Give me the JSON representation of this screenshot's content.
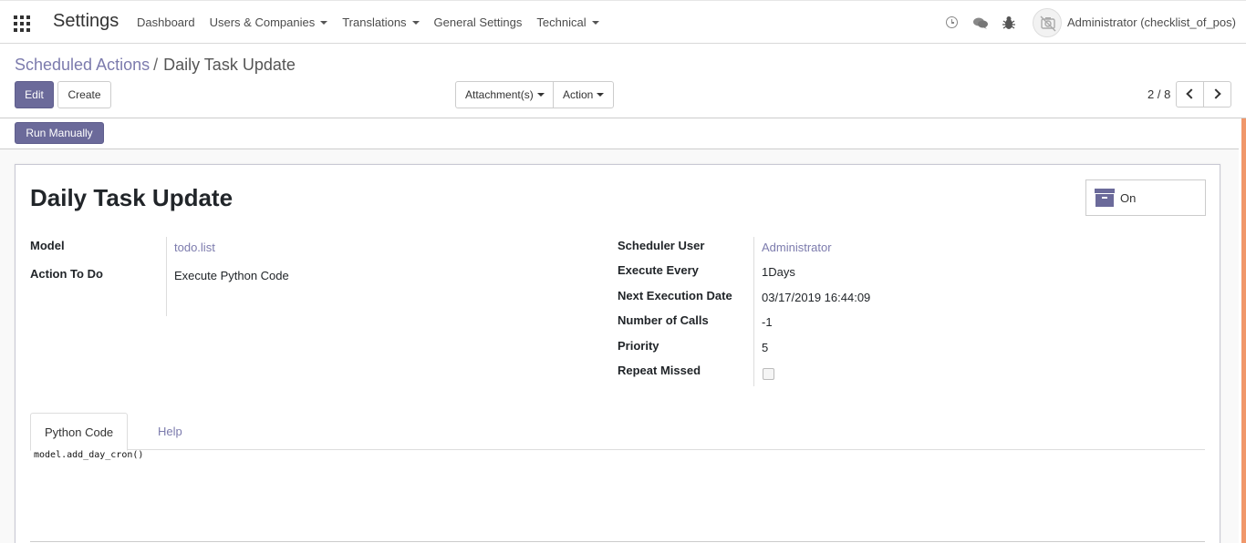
{
  "navbar": {
    "brand": "Settings",
    "menu": [
      {
        "label": "Dashboard",
        "dropdown": false
      },
      {
        "label": "Users & Companies",
        "dropdown": true
      },
      {
        "label": "Translations",
        "dropdown": true
      },
      {
        "label": "General Settings",
        "dropdown": false
      },
      {
        "label": "Technical",
        "dropdown": true
      }
    ],
    "user": "Administrator (checklist_of_pos)",
    "icons": [
      "apps-icon",
      "clock-icon",
      "chat-icon",
      "bug-icon"
    ]
  },
  "breadcrumb": {
    "parent": "Scheduled Actions",
    "separator": "/",
    "current": "Daily Task Update"
  },
  "buttons": {
    "edit": "Edit",
    "create": "Create",
    "attachments": "Attachment(s)",
    "action": "Action",
    "run_manually": "Run Manually"
  },
  "pager": {
    "value": "2 / 8"
  },
  "record": {
    "title": "Daily Task Update",
    "active_toggle": "On",
    "left_fields": [
      {
        "label": "Model",
        "value": "todo.list",
        "link": true
      },
      {
        "label": "Action To Do",
        "value": "Execute Python Code",
        "link": false
      }
    ],
    "right_fields": [
      {
        "label": "Scheduler User",
        "value": "Administrator",
        "link": true
      },
      {
        "label": "Execute Every",
        "value": "1Days",
        "link": false
      },
      {
        "label": "Next Execution Date",
        "value": "03/17/2019 16:44:09",
        "link": false
      },
      {
        "label": "Number of Calls",
        "value": "-1",
        "link": false
      },
      {
        "label": "Priority",
        "value": "5",
        "link": false
      },
      {
        "label": "Repeat Missed",
        "value": "",
        "link": false
      }
    ],
    "repeat_missed_checked": false
  },
  "tabs": [
    {
      "label": "Python Code",
      "active": true
    },
    {
      "label": "Help",
      "active": false
    }
  ],
  "code": "model.add_day_cron()",
  "colors": {
    "accent": "#7c7bad",
    "primary_button": "#6b6a9a",
    "scroll_accent": "#f0976a"
  }
}
